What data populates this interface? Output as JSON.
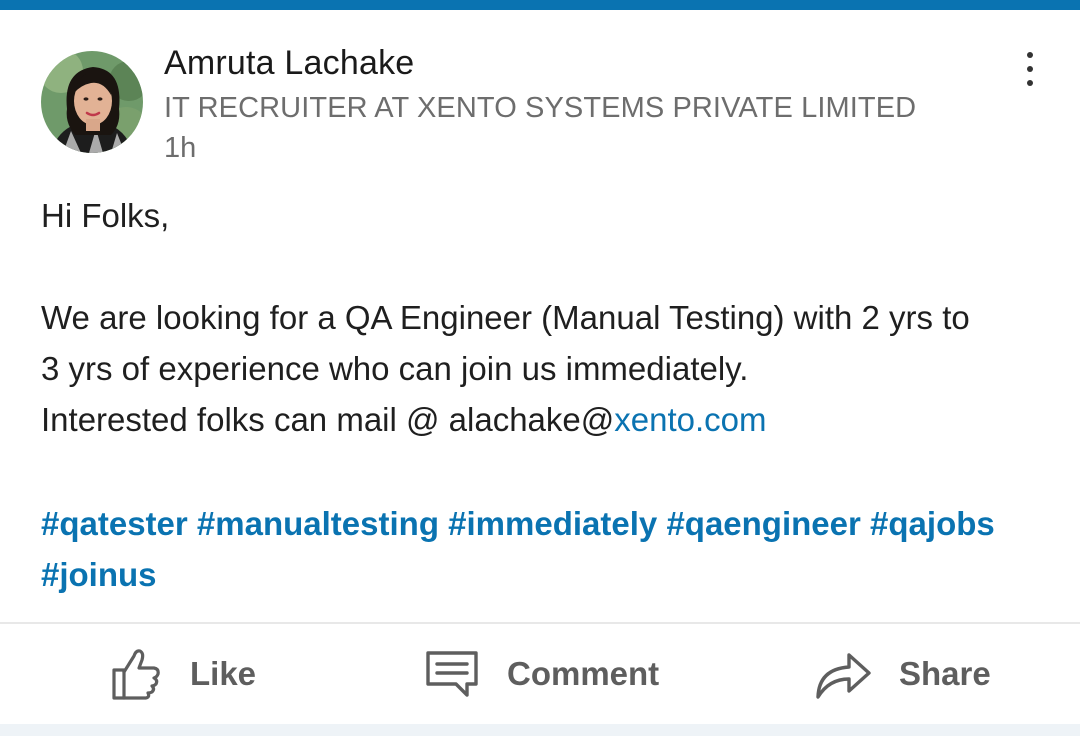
{
  "post": {
    "author": {
      "name": "Amruta Lachake",
      "headline": "IT RECRUITER AT XENTO SYSTEMS PRIVATE LIMITED",
      "time": "1h"
    },
    "body": {
      "greeting": "Hi Folks,",
      "line1": "We are looking for a QA Engineer (Manual Testing) with 2 yrs to",
      "line2": "3 yrs of experience who can join us immediately.",
      "line3_prefix": "Interested folks can mail @ alachake@",
      "line3_link": "xento.com"
    },
    "hashtags": [
      "#qatester",
      "#manualtesting",
      "#immediately",
      "#qaengineer",
      "#qajobs",
      "#joinus"
    ]
  },
  "actions": {
    "like_label": "Like",
    "comment_label": "Comment",
    "share_label": "Share"
  },
  "icons": {
    "avatar": "profile-photo",
    "more": "more-vertical-icon",
    "like": "thumbs-up-icon",
    "comment": "comment-icon",
    "share": "share-arrow-icon"
  },
  "colors": {
    "accent": "#0a73b1",
    "name_text": "#1a1a1a",
    "secondary_text": "#6d6d6d",
    "action_text": "#5e5e5e"
  }
}
